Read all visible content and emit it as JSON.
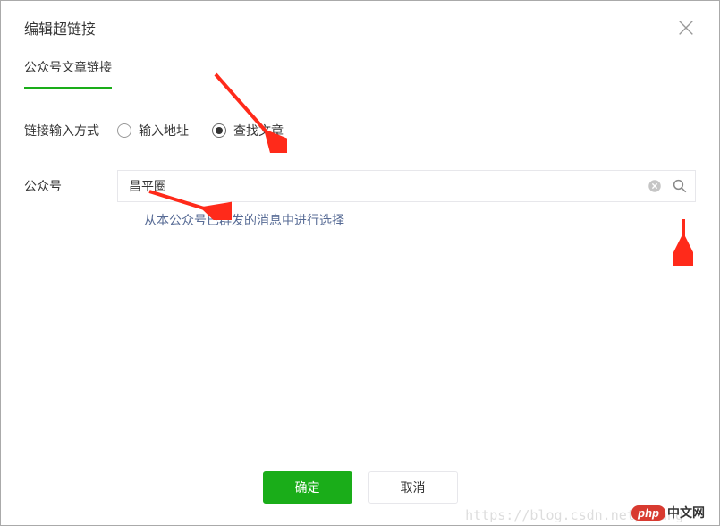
{
  "header": {
    "title": "编辑超链接"
  },
  "tabs": {
    "active_label": "公众号文章链接"
  },
  "form": {
    "input_method_label": "链接输入方式",
    "radio_options": {
      "input_url": "输入地址",
      "search_article": "查找文章"
    },
    "account_label": "公众号",
    "account_input_value": "昌平圈",
    "select_from_sent_link": "从本公众号已群发的消息中进行选择"
  },
  "footer": {
    "ok_label": "确定",
    "cancel_label": "取消"
  },
  "watermark": "https://blog.csdn.net/xiang",
  "logo": {
    "php": "php",
    "cn": "中文网"
  }
}
